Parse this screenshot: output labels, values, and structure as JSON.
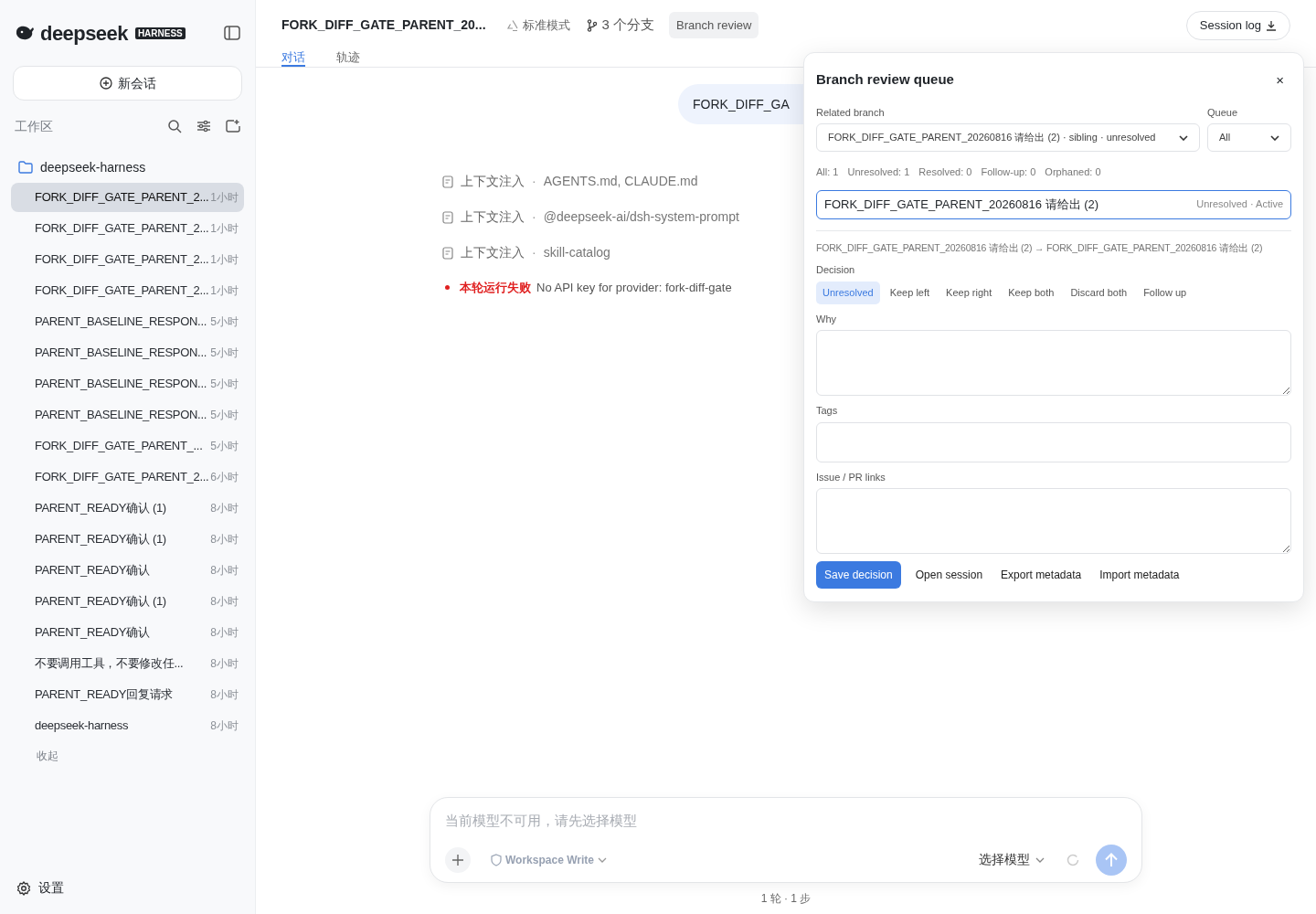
{
  "sidebar": {
    "logo": "deepseek",
    "logo_badge": "HARNESS",
    "new_chat": "新会话",
    "workspace_label": "工作区",
    "folder": "deepseek-harness",
    "items": [
      {
        "label": "FORK_DIFF_GATE_PARENT_2...",
        "time": "1小时",
        "selected": true
      },
      {
        "label": "FORK_DIFF_GATE_PARENT_2...",
        "time": "1小时",
        "selected": false
      },
      {
        "label": "FORK_DIFF_GATE_PARENT_2...",
        "time": "1小时",
        "selected": false
      },
      {
        "label": "FORK_DIFF_GATE_PARENT_2...",
        "time": "1小时",
        "selected": false
      },
      {
        "label": "PARENT_BASELINE_RESPON...",
        "time": "5小时",
        "selected": false
      },
      {
        "label": "PARENT_BASELINE_RESPON...",
        "time": "5小时",
        "selected": false
      },
      {
        "label": "PARENT_BASELINE_RESPON...",
        "time": "5小时",
        "selected": false
      },
      {
        "label": "PARENT_BASELINE_RESPON...",
        "time": "5小时",
        "selected": false
      },
      {
        "label": "FORK_DIFF_GATE_PARENT_...",
        "time": "5小时",
        "selected": false
      },
      {
        "label": "FORK_DIFF_GATE_PARENT_2...",
        "time": "6小时",
        "selected": false
      },
      {
        "label": "PARENT_READY确认 (1)",
        "time": "8小时",
        "selected": false
      },
      {
        "label": "PARENT_READY确认 (1)",
        "time": "8小时",
        "selected": false
      },
      {
        "label": "PARENT_READY确认",
        "time": "8小时",
        "selected": false
      },
      {
        "label": "PARENT_READY确认 (1)",
        "time": "8小时",
        "selected": false
      },
      {
        "label": "PARENT_READY确认",
        "time": "8小时",
        "selected": false
      },
      {
        "label": "不要调用工具，不要修改任...",
        "time": "8小时",
        "selected": false
      },
      {
        "label": "PARENT_READY回复请求",
        "time": "8小时",
        "selected": false
      },
      {
        "label": "deepseek-harness",
        "time": "8小时",
        "selected": false
      }
    ],
    "collapse": "收起",
    "settings": "设置"
  },
  "header": {
    "title": "FORK_DIFF_GATE_PARENT_20...",
    "mode": "标准模式",
    "branches": "3 个分支",
    "badge": "Branch review",
    "session_log": "Session log",
    "tabs": [
      {
        "label": "对话",
        "selected": true
      },
      {
        "label": "轨迹",
        "selected": false
      }
    ]
  },
  "chat": {
    "user_message": "FORK_DIFF_GA",
    "context": [
      {
        "label": "上下文注入",
        "separator": "·",
        "value": "AGENTS.md, CLAUDE.md"
      },
      {
        "label": "上下文注入",
        "separator": "·",
        "value": "@deepseek-ai/dsh-system-prompt"
      },
      {
        "label": "上下文注入",
        "separator": "·",
        "value": "skill-catalog"
      }
    ],
    "error": {
      "label": "本轮运行失败",
      "message": "No API key for provider: fork-diff-gate"
    }
  },
  "review_panel": {
    "title": "Branch review queue",
    "close": "×",
    "related_branch_label": "Related branch",
    "related_branch": "FORK_DIFF_GATE_PARENT_20260816 请给出 (2) · sibling · unresolved",
    "queue_label": "Queue",
    "queue": "All",
    "counts": [
      "All: 1",
      "Unresolved: 1",
      "Resolved: 0",
      "Follow-up: 0",
      "Orphaned: 0"
    ],
    "entry": {
      "name": "FORK_DIFF_GATE_PARENT_20260816 请给出 (2)",
      "status": "Unresolved · Active",
      "selected": true
    },
    "path": "FORK_DIFF_GATE_PARENT_20260816 请给出 (2) → FORK_DIFF_GATE_PARENT_20260816 请给出 (2)",
    "decision_label": "Decision",
    "decisions": [
      {
        "label": "Unresolved",
        "selected": true
      },
      {
        "label": "Keep left",
        "selected": false
      },
      {
        "label": "Keep right",
        "selected": false
      },
      {
        "label": "Keep both",
        "selected": false
      },
      {
        "label": "Discard both",
        "selected": false
      },
      {
        "label": "Follow up",
        "selected": false
      }
    ],
    "fields": [
      {
        "label": "Why",
        "kind": "textarea"
      },
      {
        "label": "Tags",
        "kind": "input"
      },
      {
        "label": "Issue / PR links",
        "kind": "textarea"
      }
    ],
    "actions": [
      {
        "label": "Save decision",
        "kind": "primary"
      },
      {
        "label": "Open session",
        "kind": "plain"
      },
      {
        "label": "Export metadata",
        "kind": "plain"
      },
      {
        "label": "Import metadata",
        "kind": "plain"
      }
    ]
  },
  "composer": {
    "placeholder": "当前模型不可用，请先选择模型",
    "permission": "Workspace Write",
    "permission_disabled": true,
    "model": "选择模型",
    "footer": "1 轮 · 1 步"
  }
}
